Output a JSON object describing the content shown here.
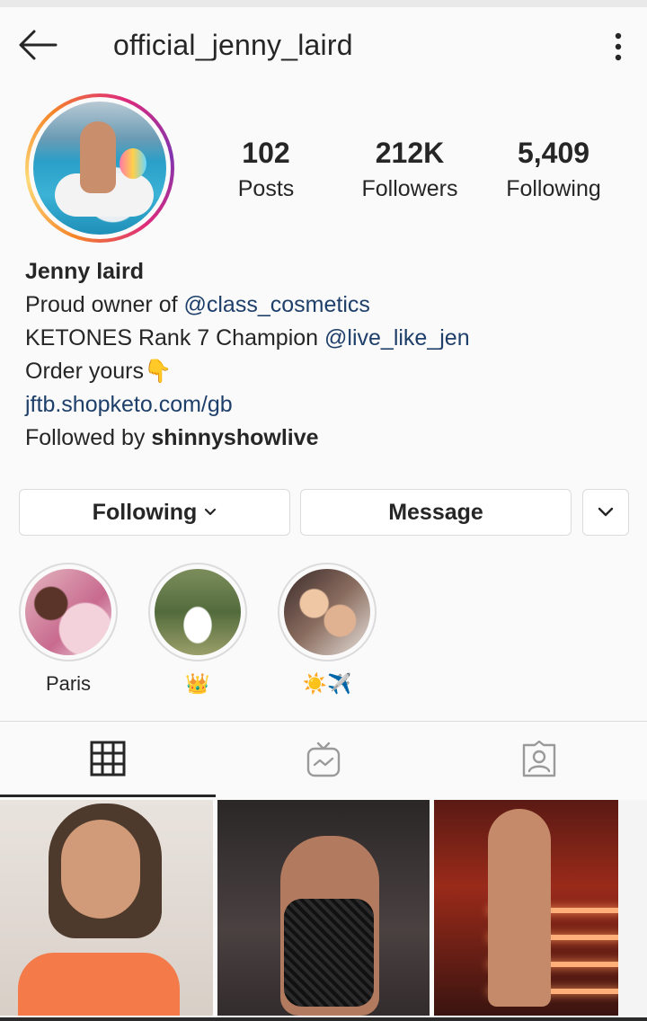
{
  "header": {
    "username": "official_jenny_laird",
    "back_icon": "arrow-left-icon",
    "more_icon": "more-vertical-icon"
  },
  "stats": {
    "posts": {
      "value": "102",
      "label": "Posts"
    },
    "followers": {
      "value": "212K",
      "label": "Followers"
    },
    "following": {
      "value": "5,409",
      "label": "Following"
    }
  },
  "bio": {
    "name": "Jenny laird",
    "line1_prefix": "Proud owner of ",
    "line1_mention": "@class_cosmetics",
    "line2_prefix": "KETONES Rank 7 Champion ",
    "line2_mention": "@live_like_jen",
    "line3": "Order yours",
    "line3_emoji": "👇",
    "link": "jftb.shopketo.com/gb",
    "followed_by_prefix": "Followed by ",
    "followed_by_user": "shinnyshowlive"
  },
  "buttons": {
    "following": "Following",
    "message": "Message"
  },
  "highlights": [
    {
      "label": "Paris"
    },
    {
      "label": "👑"
    },
    {
      "label": "☀️✈️"
    }
  ],
  "tabs": [
    {
      "icon": "grid-icon",
      "active": true
    },
    {
      "icon": "igtv-icon",
      "active": false
    },
    {
      "icon": "tagged-icon",
      "active": false
    }
  ],
  "colors": {
    "link": "#1e3f6a",
    "text": "#262626",
    "border": "#dbdbdb",
    "background": "#fafafa"
  }
}
